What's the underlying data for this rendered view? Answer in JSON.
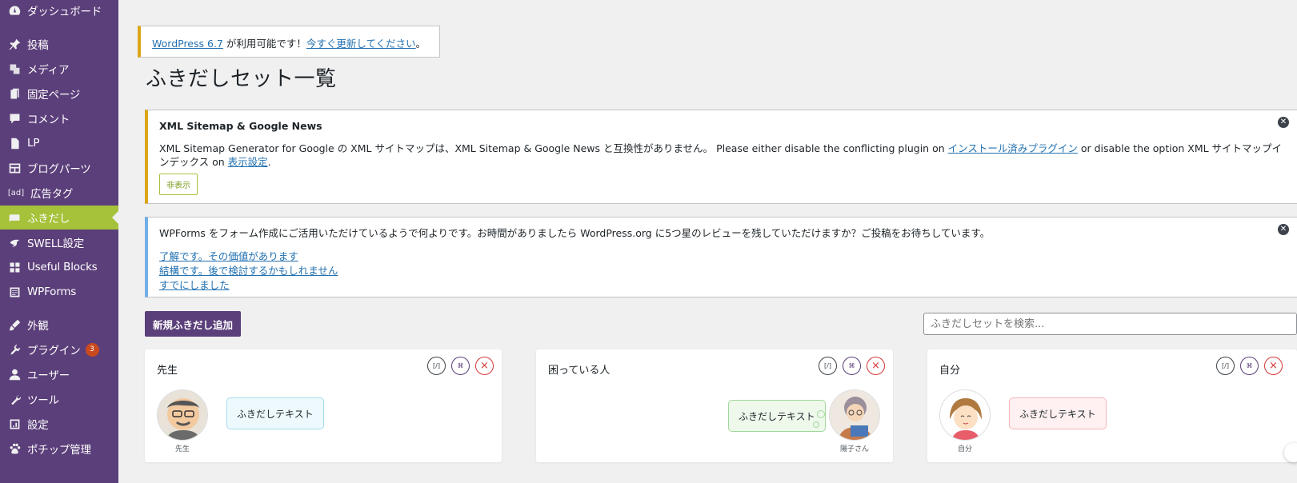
{
  "sidebar": {
    "items": [
      {
        "label": "ダッシュボード",
        "icon": "dashboard-icon"
      },
      {
        "label": "投稿",
        "icon": "pin-icon"
      },
      {
        "label": "メディア",
        "icon": "media-icon"
      },
      {
        "label": "固定ページ",
        "icon": "page-icon"
      },
      {
        "label": "コメント",
        "icon": "comment-icon"
      },
      {
        "label": "LP",
        "icon": "document-icon"
      },
      {
        "label": "ブログパーツ",
        "icon": "layout-icon"
      },
      {
        "label": "広告タグ",
        "icon": "ad-icon"
      },
      {
        "label": "ふきだし",
        "icon": "speech-bubble-icon"
      },
      {
        "label": "SWELL設定",
        "icon": "bird-icon"
      },
      {
        "label": "Useful Blocks",
        "icon": "grid-icon"
      },
      {
        "label": "WPForms",
        "icon": "form-icon"
      },
      {
        "label": "外観",
        "icon": "brush-icon"
      },
      {
        "label": "プラグイン",
        "icon": "plugin-icon",
        "badge": "3"
      },
      {
        "label": "ユーザー",
        "icon": "user-icon"
      },
      {
        "label": "ツール",
        "icon": "wrench-icon"
      },
      {
        "label": "設定",
        "icon": "settings-icon"
      },
      {
        "label": "ポチップ管理",
        "icon": "paw-icon"
      }
    ],
    "active": "ふきだし"
  },
  "update_nag": {
    "link1": "WordPress 6.7",
    "text": " が利用可能です！",
    "link2": "今すぐ更新してください",
    "end": "。"
  },
  "page_title": "ふきだしセット一覧",
  "notice_xml": {
    "title": "XML Sitemap & Google News",
    "body_prefix": "XML Sitemap Generator for Google の XML サイトマップは、XML Sitemap & Google News と互換性がありません。 Please either disable the conflicting plugin on ",
    "link1": "インストール済みプラグイン",
    "body_middle": " or disable the option XML サイトマップインデックス on ",
    "link2": "表示設定",
    "body_end": ".",
    "hide_button": "非表示"
  },
  "notice_wpforms": {
    "body": "WPForms をフォーム作成にご活用いただけているようで何よりです。お時間がありましたら WordPress.org に5つ星のレビューを残していただけますか？ご投稿をお待ちしています。",
    "links": [
      "了解です。その価値があります",
      "結構です。後で検討するかもしれません",
      "すでにしました"
    ]
  },
  "add_button": "新規ふきだし追加",
  "search_placeholder": "ふきだしセットを検索...",
  "cards": [
    {
      "title": "先生",
      "avatar_label": "先生",
      "bubble": "ふきだしテキスト",
      "style": "left-blue"
    },
    {
      "title": "困っている人",
      "avatar_label": "陽子さん",
      "bubble": "ふきだしテキスト",
      "style": "right-green-think"
    },
    {
      "title": "自分",
      "avatar_label": "自分",
      "bubble": "ふきだしテキスト",
      "style": "left-pink"
    }
  ],
  "card_actions": {
    "edit": "[/]",
    "duplicate": "⌘",
    "delete": "×"
  }
}
